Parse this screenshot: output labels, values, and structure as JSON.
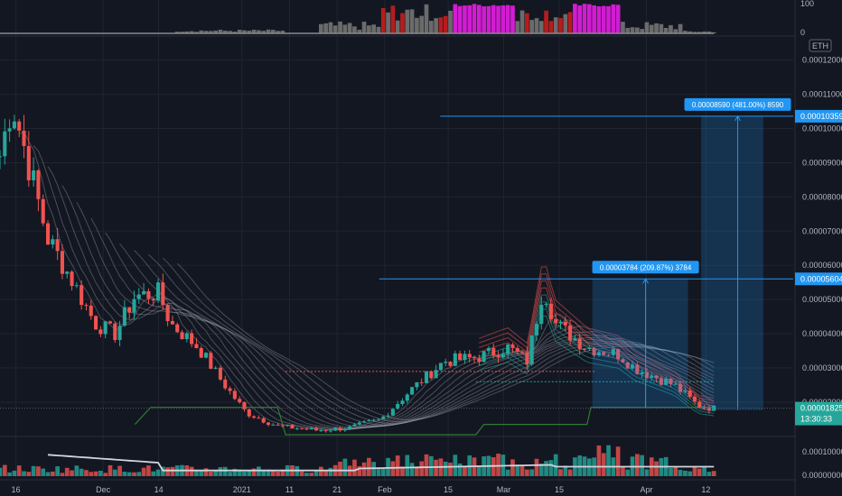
{
  "chart_data": {
    "type": "candlestick",
    "currency_label": "ETH",
    "indicator_levels": [
      "100",
      "0"
    ],
    "price_axis": {
      "ticks": [
        "0.00012000",
        "0.00011000",
        "0.00010000",
        "0.00009000",
        "0.00008000",
        "0.00007000",
        "0.00006000",
        "0.00005000",
        "0.00004000",
        "0.00003000",
        "0.00002000"
      ],
      "range": [
        1.05e-05,
        0.0001265
      ]
    },
    "volume_axis": {
      "ticks": [
        "0.00010000",
        "0.00000000"
      ]
    },
    "x_ticks": [
      "16",
      "Dec",
      "14",
      "2021",
      "11",
      "21",
      "Feb",
      "15",
      "Mar",
      "15",
      "Apr",
      "12"
    ],
    "x_tick_positions": [
      0.02,
      0.13,
      0.2,
      0.305,
      0.365,
      0.425,
      0.485,
      0.565,
      0.635,
      0.705,
      0.815,
      0.89
    ],
    "price_tags": {
      "upper": "0.00010359",
      "mid": "0.00005604",
      "current": "0.00001825",
      "countdown": "13:30:33"
    },
    "annotations": [
      {
        "text": "0.00003784 (209.87%) 3784",
        "from": 1.82e-05,
        "to": 5.604e-05
      },
      {
        "text": "0.00008590 (481.00%) 8590",
        "from": 1.77e-05,
        "to": 0.00010359
      }
    ],
    "colors": {
      "up": "#26a69a",
      "down": "#ef5350",
      "bg": "#131722",
      "grid": "#1f2430",
      "guide": "#2196f3",
      "hist_mid": "#d21cd2",
      "hist_red": "#b71c1c",
      "hist_gray": "#6b6b6b",
      "green_line": "#2e7d32"
    },
    "series_keypoints": [
      [
        0,
        9.2e-05
      ],
      [
        0.015,
        0.000108
      ],
      [
        0.03,
        9.5e-05
      ],
      [
        0.06,
        6.8e-05
      ],
      [
        0.09,
        5.6e-05
      ],
      [
        0.12,
        4.3e-05
      ],
      [
        0.145,
        4e-05
      ],
      [
        0.17,
        5.1e-05
      ],
      [
        0.2,
        5.2e-05
      ],
      [
        0.215,
        4.3e-05
      ],
      [
        0.25,
        3.6e-05
      ],
      [
        0.28,
        2.6e-05
      ],
      [
        0.31,
        1.7e-05
      ],
      [
        0.35,
        1.3e-05
      ],
      [
        0.4,
        1.18e-05
      ],
      [
        0.44,
        1.25e-05
      ],
      [
        0.48,
        1.5e-05
      ],
      [
        0.52,
        2.4e-05
      ],
      [
        0.56,
        3.2e-05
      ],
      [
        0.6,
        3.3e-05
      ],
      [
        0.64,
        3.6e-05
      ],
      [
        0.665,
        3.2e-05
      ],
      [
        0.685,
        5.4e-05
      ],
      [
        0.7,
        4.3e-05
      ],
      [
        0.74,
        3.6e-05
      ],
      [
        0.78,
        3.4e-05
      ],
      [
        0.8,
        3e-05
      ],
      [
        0.82,
        2.8e-05
      ],
      [
        0.85,
        2.5e-05
      ],
      [
        0.88,
        1.9e-05
      ],
      [
        0.9,
        1.82e-05
      ]
    ]
  }
}
